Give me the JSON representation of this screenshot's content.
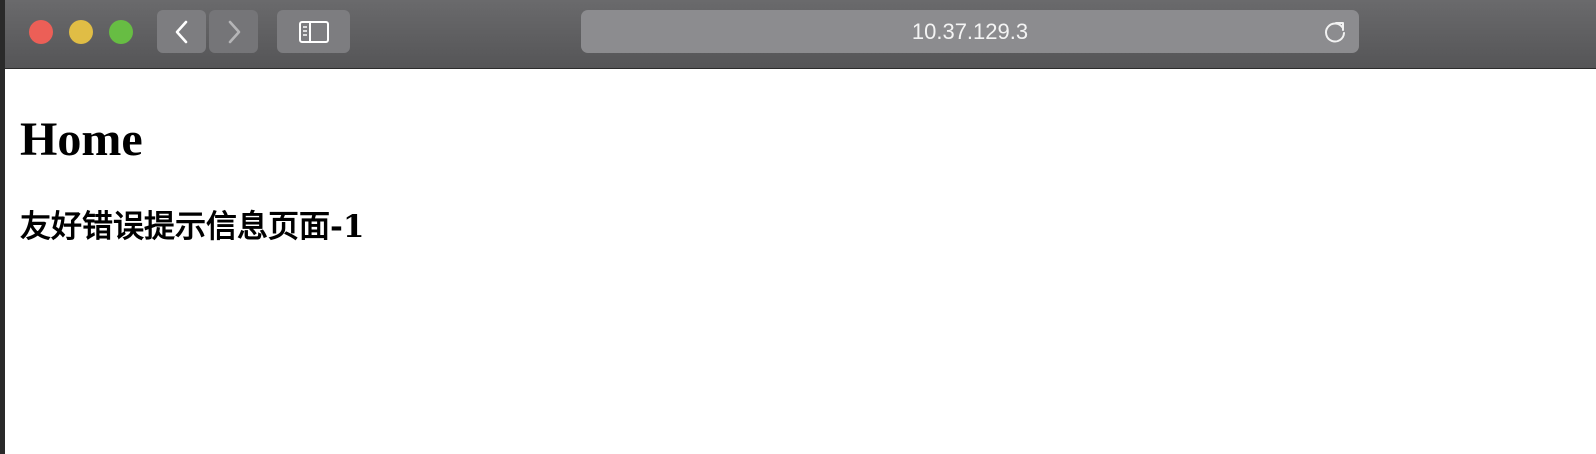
{
  "browser": {
    "address": "10.37.129.3",
    "icons": {
      "back": "chevron-left-icon",
      "forward": "chevron-right-icon",
      "sidebar": "sidebar-icon",
      "reload": "reload-icon"
    },
    "colors": {
      "close": "#ec5f57",
      "minimize": "#e0bd45",
      "zoom": "#67bd43"
    }
  },
  "page": {
    "title": "Home",
    "message": "友好错误提示信息页面-1"
  }
}
